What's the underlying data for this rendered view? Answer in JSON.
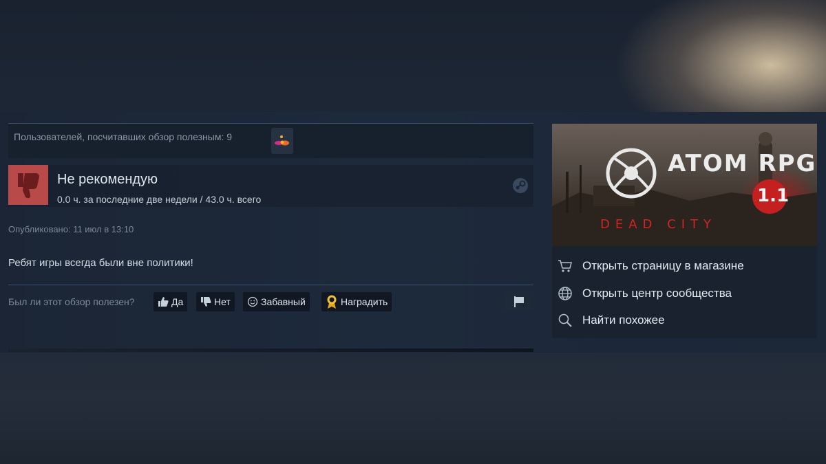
{
  "helpful": {
    "text": "Пользователей, посчитавших обзор полезным: 9",
    "award_icon": "award-icon"
  },
  "review": {
    "verdict": "Не рекомендую",
    "hours": "0.0 ч. за последние две недели / 43.0 ч. всего",
    "posted": "Опубликовано: 11 июл в 13:10",
    "text": "Ребят игры всегда были вне политики!",
    "verdict_color": "#b84a4a"
  },
  "vote": {
    "question": "Был ли этот обзор полезен?",
    "yes": "Да",
    "no": "Нет",
    "funny": "Забавный",
    "award": "Наградить"
  },
  "sidebar": {
    "game_title": "ATOM RPG",
    "game_version": "1.1",
    "game_subtitle": "DEAD CITY",
    "links": [
      {
        "label": "Открыть страницу в магазине",
        "icon": "cart-icon"
      },
      {
        "label": "Открыть центр сообщества",
        "icon": "globe-icon"
      },
      {
        "label": "Найти похожее",
        "icon": "search-icon"
      }
    ]
  }
}
